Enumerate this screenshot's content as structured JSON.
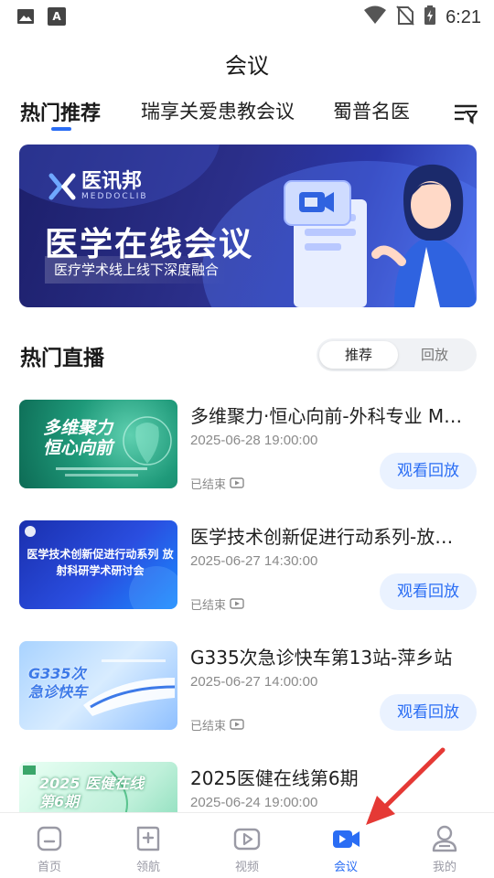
{
  "status_bar": {
    "time": "6:21",
    "left_badge": "A"
  },
  "header": {
    "title": "会议"
  },
  "tabs": [
    {
      "label": "热门推荐",
      "active": true
    },
    {
      "label": "瑞享关爱患教会议",
      "active": false
    },
    {
      "label": "蜀普名医",
      "active": false
    }
  ],
  "banner": {
    "logo_cn": "医讯邦",
    "logo_en": "MEDDOCLIB",
    "title": "医学在线会议",
    "subtitle": "医疗学术线上线下深度融合"
  },
  "live_section": {
    "title": "热门直播",
    "segments": [
      {
        "label": "推荐",
        "active": true
      },
      {
        "label": "回放",
        "active": false
      }
    ]
  },
  "meetings": [
    {
      "title": "多维聚力·恒心向前-外科专业 M…",
      "time": "2025-06-28 19:00:00",
      "status": "已结束",
      "button": "观看回放",
      "thumb_text": "多维聚力 恒心向前"
    },
    {
      "title": "医学技术创新促进行动系列-放…",
      "time": "2025-06-27 14:30:00",
      "status": "已结束",
      "button": "观看回放",
      "thumb_text": "医学技术创新促进行动系列 放射科研学术研讨会"
    },
    {
      "title": "G335次急诊快车第13站-萍乡站",
      "time": "2025-06-27 14:00:00",
      "status": "已结束",
      "button": "观看回放",
      "thumb_text": "G335次 急诊快车"
    },
    {
      "title": "2025医健在线第6期",
      "time": "2025-06-24 19:00:00",
      "status": "",
      "button": "",
      "thumb_text": "2025 医健在线 第6期"
    }
  ],
  "bottom_nav": [
    {
      "label": "首页",
      "icon": "home-icon",
      "active": false
    },
    {
      "label": "领航",
      "icon": "compass-icon",
      "active": false
    },
    {
      "label": "视频",
      "icon": "video-icon",
      "active": false
    },
    {
      "label": "会议",
      "icon": "meeting-camera-icon",
      "active": true
    },
    {
      "label": "我的",
      "icon": "profile-icon",
      "active": false
    }
  ],
  "colors": {
    "accent": "#2a6df4",
    "annotation": "#e53935"
  }
}
